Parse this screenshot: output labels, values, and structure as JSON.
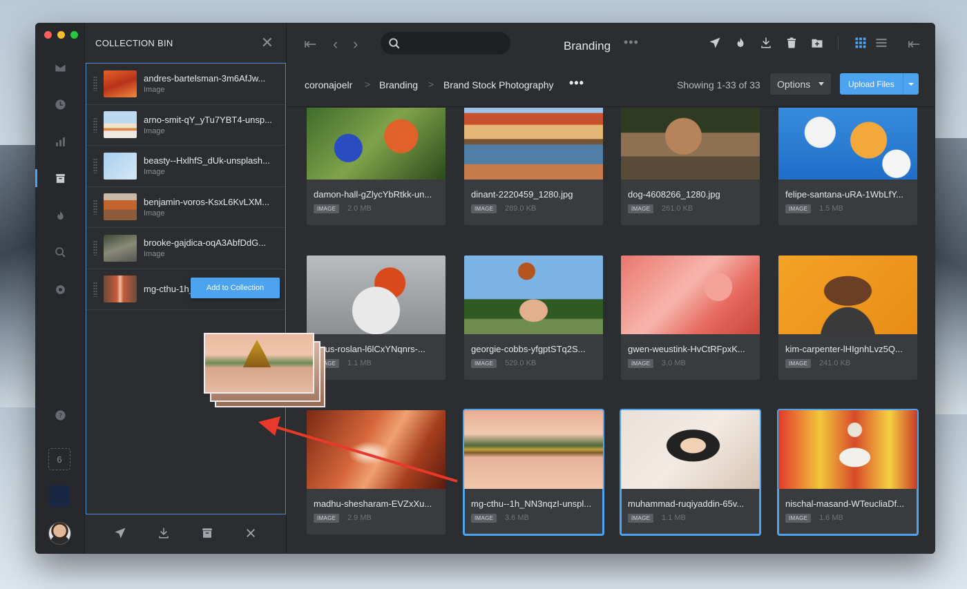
{
  "bin": {
    "title": "COLLECTION BIN",
    "items": [
      {
        "name": "andres-bartelsman-3m6AfJw...",
        "type": "Image"
      },
      {
        "name": "arno-smit-qY_yTu7YBT4-unsp...",
        "type": "Image"
      },
      {
        "name": "beasty--HxlhfS_dUk-unsplash...",
        "type": "Image"
      },
      {
        "name": "benjamin-voros-KsxL6KvLXM...",
        "type": "Image"
      },
      {
        "name": "brooke-gajdica-oqA3AbfDdG...",
        "type": "Image"
      },
      {
        "name": "mg-cthu-1h_NN3...1280.jpg",
        "type": ""
      }
    ],
    "add_button": "Add to Collection"
  },
  "rail": {
    "badge_count": "6"
  },
  "topbar": {
    "title": "Branding",
    "more": "•••"
  },
  "breadcrumb": {
    "items": [
      "coronajoelr",
      "Branding",
      "Brand Stock Photography"
    ],
    "separator": ">",
    "more": "•••"
  },
  "showing": "Showing 1-33 of 33",
  "options_label": "Options",
  "upload_label": "Upload Files",
  "colors": {
    "accent": "#4da3f0",
    "window_bg": "#2b2d30",
    "card_bg": "#393b3f"
  },
  "cards": [
    {
      "name": "damon-hall-gZlycYbRtkk-un...",
      "tag": "IMAGE",
      "size": "2.0 MB",
      "selected": false
    },
    {
      "name": "dinant-2220459_1280.jpg",
      "tag": "IMAGE",
      "size": "289.0 KB",
      "selected": false
    },
    {
      "name": "dog-4608266_1280.jpg",
      "tag": "IMAGE",
      "size": "261.0 KB",
      "selected": false
    },
    {
      "name": "felipe-santana-uRA-1WbLfY...",
      "tag": "IMAGE",
      "size": "1.5 MB",
      "selected": false
    },
    {
      "name": "klaus-roslan-l6lCxYNqnrs-...",
      "tag": "IMAGE",
      "size": "1.1 MB",
      "selected": false
    },
    {
      "name": "georgie-cobbs-yfgptSTq2S...",
      "tag": "IMAGE",
      "size": "529.0 KB",
      "selected": false
    },
    {
      "name": "gwen-weustink-HvCtRFpxK...",
      "tag": "IMAGE",
      "size": "3.0 MB",
      "selected": false
    },
    {
      "name": "kim-carpenter-lHIgnhLvz5Q...",
      "tag": "IMAGE",
      "size": "241.0 KB",
      "selected": false
    },
    {
      "name": "madhu-shesharam-EVZxXu...",
      "tag": "IMAGE",
      "size": "2.9 MB",
      "selected": false
    },
    {
      "name": "mg-cthu--1h_NN3nqzI-unspl...",
      "tag": "IMAGE",
      "size": "3.6 MB",
      "selected": true
    },
    {
      "name": "muhammad-ruqiyaddin-65v...",
      "tag": "IMAGE",
      "size": "1.1 MB",
      "selected": true
    },
    {
      "name": "nischal-masand-WTeucliaDf...",
      "tag": "IMAGE",
      "size": "1.6 MB",
      "selected": true
    }
  ]
}
